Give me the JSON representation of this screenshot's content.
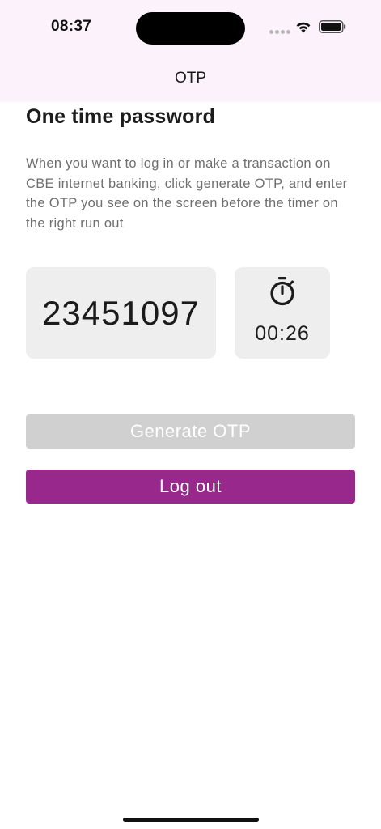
{
  "status_bar": {
    "time": "08:37",
    "icons": [
      "signal-icon",
      "wifi-icon",
      "battery-icon"
    ]
  },
  "nav": {
    "title": "OTP"
  },
  "main": {
    "title": "One time password",
    "description": "When you want to log in or make a transaction on CBE internet banking, click generate OTP, and enter the OTP you see on the screen before the timer on the right run out",
    "otp_code": "23451097",
    "timer": {
      "icon": "stopwatch-icon",
      "value": "00:26"
    },
    "buttons": {
      "generate_label": "Generate OTP",
      "logout_label": "Log out"
    }
  },
  "colors": {
    "header_background": "#fcf2fb",
    "accent": "#98288b",
    "disabled_button": "#d0d0d0",
    "card_background": "#eeeeee"
  }
}
